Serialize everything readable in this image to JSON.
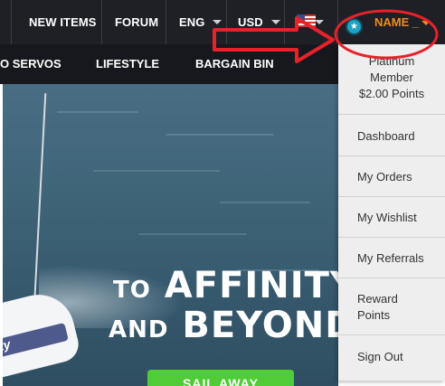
{
  "top_nav": {
    "items": [
      "NEW ITEMS",
      "FORUM",
      "ENG",
      "USD"
    ],
    "user_name": "NAME _"
  },
  "sub_nav": {
    "items": [
      "O SERVOS",
      "LIFESTYLE",
      "BARGAIN BIN"
    ]
  },
  "hero": {
    "line1_small": "TO",
    "line1_big": "AFFINITY",
    "line2_small": "AND",
    "line2_big": "BEYOND",
    "cta_label": "SAIL AWAY",
    "boat_label": "ity"
  },
  "account_menu": {
    "membership": [
      "Platinum",
      "Member",
      "$2.00 Points"
    ],
    "items": [
      "Dashboard",
      "My Orders",
      "My Wishlist",
      "My Referrals",
      "Reward",
      "Points",
      "Sign Out"
    ]
  },
  "colors": {
    "nav_bg": "#1e2026",
    "accent_orange": "#f08a1e",
    "annotation_red": "#e8222a",
    "cta_green": "#4fcc36"
  },
  "icons": [
    "user-badge-icon",
    "us-flag-icon",
    "caret-down-icon"
  ]
}
